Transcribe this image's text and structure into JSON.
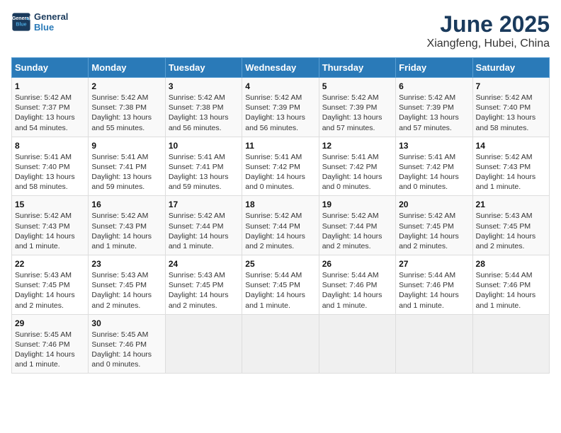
{
  "header": {
    "logo_line1": "General",
    "logo_line2": "Blue",
    "title": "June 2025",
    "subtitle": "Xiangfeng, Hubei, China"
  },
  "calendar": {
    "days_of_week": [
      "Sunday",
      "Monday",
      "Tuesday",
      "Wednesday",
      "Thursday",
      "Friday",
      "Saturday"
    ],
    "weeks": [
      [
        {
          "day": "",
          "info": ""
        },
        {
          "day": "2",
          "info": "Sunrise: 5:42 AM\nSunset: 7:38 PM\nDaylight: 13 hours\nand 55 minutes."
        },
        {
          "day": "3",
          "info": "Sunrise: 5:42 AM\nSunset: 7:38 PM\nDaylight: 13 hours\nand 56 minutes."
        },
        {
          "day": "4",
          "info": "Sunrise: 5:42 AM\nSunset: 7:39 PM\nDaylight: 13 hours\nand 56 minutes."
        },
        {
          "day": "5",
          "info": "Sunrise: 5:42 AM\nSunset: 7:39 PM\nDaylight: 13 hours\nand 57 minutes."
        },
        {
          "day": "6",
          "info": "Sunrise: 5:42 AM\nSunset: 7:39 PM\nDaylight: 13 hours\nand 57 minutes."
        },
        {
          "day": "7",
          "info": "Sunrise: 5:42 AM\nSunset: 7:40 PM\nDaylight: 13 hours\nand 58 minutes."
        }
      ],
      [
        {
          "day": "1",
          "info": "Sunrise: 5:42 AM\nSunset: 7:37 PM\nDaylight: 13 hours\nand 54 minutes."
        },
        {
          "day": "9",
          "info": "Sunrise: 5:41 AM\nSunset: 7:41 PM\nDaylight: 13 hours\nand 59 minutes."
        },
        {
          "day": "10",
          "info": "Sunrise: 5:41 AM\nSunset: 7:41 PM\nDaylight: 13 hours\nand 59 minutes."
        },
        {
          "day": "11",
          "info": "Sunrise: 5:41 AM\nSunset: 7:42 PM\nDaylight: 14 hours\nand 0 minutes."
        },
        {
          "day": "12",
          "info": "Sunrise: 5:41 AM\nSunset: 7:42 PM\nDaylight: 14 hours\nand 0 minutes."
        },
        {
          "day": "13",
          "info": "Sunrise: 5:41 AM\nSunset: 7:42 PM\nDaylight: 14 hours\nand 0 minutes."
        },
        {
          "day": "14",
          "info": "Sunrise: 5:42 AM\nSunset: 7:43 PM\nDaylight: 14 hours\nand 1 minute."
        }
      ],
      [
        {
          "day": "8",
          "info": "Sunrise: 5:41 AM\nSunset: 7:40 PM\nDaylight: 13 hours\nand 58 minutes."
        },
        {
          "day": "16",
          "info": "Sunrise: 5:42 AM\nSunset: 7:43 PM\nDaylight: 14 hours\nand 1 minute."
        },
        {
          "day": "17",
          "info": "Sunrise: 5:42 AM\nSunset: 7:44 PM\nDaylight: 14 hours\nand 1 minute."
        },
        {
          "day": "18",
          "info": "Sunrise: 5:42 AM\nSunset: 7:44 PM\nDaylight: 14 hours\nand 2 minutes."
        },
        {
          "day": "19",
          "info": "Sunrise: 5:42 AM\nSunset: 7:44 PM\nDaylight: 14 hours\nand 2 minutes."
        },
        {
          "day": "20",
          "info": "Sunrise: 5:42 AM\nSunset: 7:45 PM\nDaylight: 14 hours\nand 2 minutes."
        },
        {
          "day": "21",
          "info": "Sunrise: 5:43 AM\nSunset: 7:45 PM\nDaylight: 14 hours\nand 2 minutes."
        }
      ],
      [
        {
          "day": "15",
          "info": "Sunrise: 5:42 AM\nSunset: 7:43 PM\nDaylight: 14 hours\nand 1 minute."
        },
        {
          "day": "23",
          "info": "Sunrise: 5:43 AM\nSunset: 7:45 PM\nDaylight: 14 hours\nand 2 minutes."
        },
        {
          "day": "24",
          "info": "Sunrise: 5:43 AM\nSunset: 7:45 PM\nDaylight: 14 hours\nand 2 minutes."
        },
        {
          "day": "25",
          "info": "Sunrise: 5:44 AM\nSunset: 7:45 PM\nDaylight: 14 hours\nand 1 minute."
        },
        {
          "day": "26",
          "info": "Sunrise: 5:44 AM\nSunset: 7:46 PM\nDaylight: 14 hours\nand 1 minute."
        },
        {
          "day": "27",
          "info": "Sunrise: 5:44 AM\nSunset: 7:46 PM\nDaylight: 14 hours\nand 1 minute."
        },
        {
          "day": "28",
          "info": "Sunrise: 5:44 AM\nSunset: 7:46 PM\nDaylight: 14 hours\nand 1 minute."
        }
      ],
      [
        {
          "day": "22",
          "info": "Sunrise: 5:43 AM\nSunset: 7:45 PM\nDaylight: 14 hours\nand 2 minutes."
        },
        {
          "day": "30",
          "info": "Sunrise: 5:45 AM\nSunset: 7:46 PM\nDaylight: 14 hours\nand 0 minutes."
        },
        {
          "day": "",
          "info": ""
        },
        {
          "day": "",
          "info": ""
        },
        {
          "day": "",
          "info": ""
        },
        {
          "day": "",
          "info": ""
        },
        {
          "day": ""
        }
      ],
      [
        {
          "day": "29",
          "info": "Sunrise: 5:45 AM\nSunset: 7:46 PM\nDaylight: 14 hours\nand 1 minute."
        },
        {
          "day": "",
          "info": ""
        },
        {
          "day": "",
          "info": ""
        },
        {
          "day": "",
          "info": ""
        },
        {
          "day": "",
          "info": ""
        },
        {
          "day": "",
          "info": ""
        },
        {
          "day": ""
        }
      ]
    ]
  }
}
